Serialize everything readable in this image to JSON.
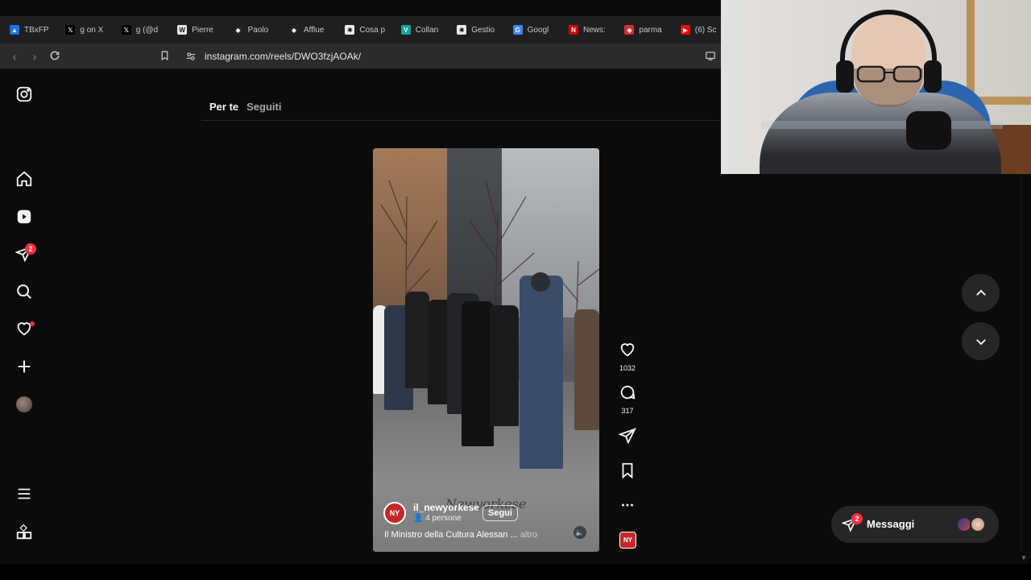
{
  "browser": {
    "tabs": [
      {
        "label": "TBxFP",
        "icon": "drive-icon",
        "color": "#1a73e8"
      },
      {
        "label": "g on X",
        "icon": "x-icon",
        "color": "#000000"
      },
      {
        "label": "g (@d",
        "icon": "x-icon",
        "color": "#000000"
      },
      {
        "label": "Pierre",
        "icon": "wikipedia-icon",
        "color": "#ffffff"
      },
      {
        "label": "Paolo",
        "icon": "site-icon",
        "color": "#222222"
      },
      {
        "label": "Afflue",
        "icon": "site-icon",
        "color": "#222222"
      },
      {
        "label": "Cosa p",
        "icon": "chatgpt-icon",
        "color": "#ffffff"
      },
      {
        "label": "Collan",
        "icon": "v-icon",
        "color": "#1aa199"
      },
      {
        "label": "Gestio",
        "icon": "chatgpt-icon",
        "color": "#ffffff"
      },
      {
        "label": "Googl",
        "icon": "google-icon",
        "color": "#4285f4"
      },
      {
        "label": "News:",
        "icon": "news-icon",
        "color": "#cc0000"
      },
      {
        "label": "parma",
        "icon": "site-icon",
        "color": "#cc3333"
      },
      {
        "label": "(6) Sc",
        "icon": "youtube-icon",
        "color": "#ff0000"
      }
    ],
    "url": "instagram.com/reels/DWO3fzjAOAk/"
  },
  "sidebar": {
    "notifications_badge": "2"
  },
  "feed_tabs": {
    "for_you": "Per te",
    "following": "Seguiti"
  },
  "reel": {
    "username": "il_newyorkese",
    "people": "4 persone",
    "follow_label": "Segui",
    "caption": "Il Ministro della Cultura Alessan ...",
    "caption_more": "altro",
    "watermark": "Newyorkese",
    "avatar_text": "NY"
  },
  "actions": {
    "likes": "1032",
    "comments": "317"
  },
  "messages": {
    "label": "Messaggi",
    "badge": "2"
  },
  "colors": {
    "accent_red": "#ff3040",
    "brand_red": "#c62828",
    "background": "#0b0b0b"
  }
}
